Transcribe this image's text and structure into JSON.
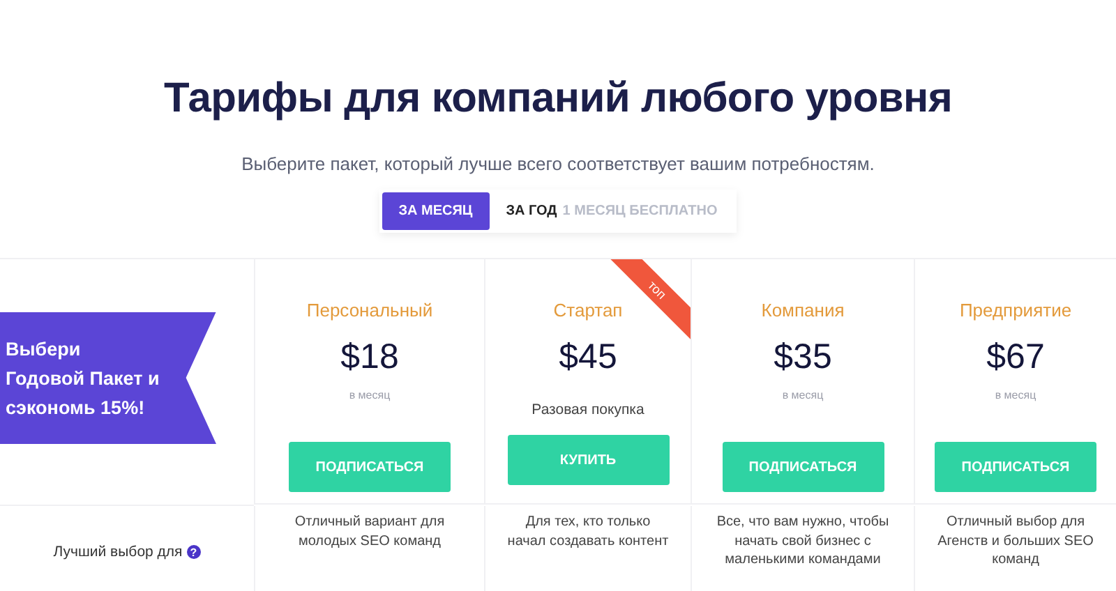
{
  "header": {
    "title": "Тарифы для компаний любого уровня",
    "subtitle": "Выберите пакет, который лучше всего соответствует вашим потребностям."
  },
  "billing_toggle": [
    {
      "label": "ЗА МЕСЯЦ",
      "selected": true
    },
    {
      "label": "ЗА ГОД",
      "note": "1 МЕСЯЦ БЕСПЛАТНО",
      "selected": false
    }
  ],
  "promo_banner": "Выбери Годовой Пакет и сэкономь 15%!",
  "plans": [
    {
      "name": "Персональный",
      "price": "$18",
      "period": "в месяц",
      "button": "ПОДПИСАТЬСЯ",
      "best_for": "Отличный вариант для молодых SEO команд"
    },
    {
      "name": "Стартап",
      "price": "$45",
      "note": "Разовая покупка",
      "ribbon": "топ",
      "button": "КУПИТЬ",
      "best_for": "Для тех, кто только начал создавать контент"
    },
    {
      "name": "Компания",
      "price": "$35",
      "period": "в месяц",
      "button": "ПОДПИСАТЬСЯ",
      "best_for": "Все, что вам нужно, чтобы начать свой бизнес с маленькими командами"
    },
    {
      "name": "Предприятие",
      "price": "$67",
      "period": "в месяц",
      "button": "ПОДПИСАТЬСЯ",
      "best_for": "Отличный выбор для Агенств и больших SEO команд"
    }
  ],
  "best_for_label": "Лучший выбор для",
  "best_for_help": "?"
}
